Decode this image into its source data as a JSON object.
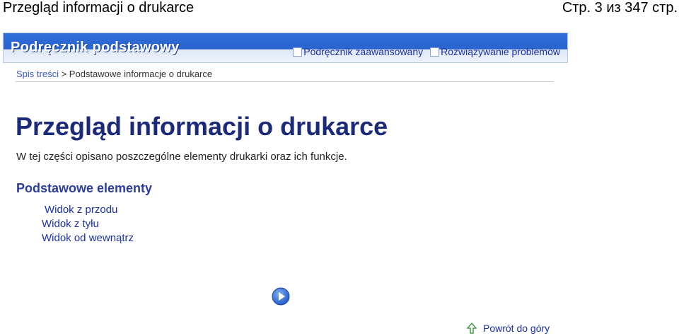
{
  "header": {
    "title": "Przegląd informacji o drukarce",
    "page_counter": "Стр. 3 из 347 стр."
  },
  "banner": {
    "title": "Podręcznik podstawowy",
    "links": [
      "Podręcznik zaawansowany",
      "Rozwiązywanie problemów"
    ]
  },
  "breadcrumb": {
    "link": "Spis treści",
    "separator": " > ",
    "current": "Podstawowe informacje o drukarce"
  },
  "content": {
    "heading": "Przegląd informacji o drukarce",
    "intro": "W tej części opisano poszczególne elementy drukarki oraz ich funkcje.",
    "section_heading": "Podstawowe elementy",
    "links": [
      "Widok z przodu",
      "Widok z tyłu",
      "Widok od wewnątrz"
    ]
  },
  "navigation": {
    "next_icon": "play-circle-icon",
    "back_to_top": "Powrót do góry",
    "back_icon": "up-arrow-icon"
  },
  "colors": {
    "banner_blue": "#2a63cd",
    "link_blue": "#1a2fa8",
    "heading_navy": "#1c2a7a"
  }
}
